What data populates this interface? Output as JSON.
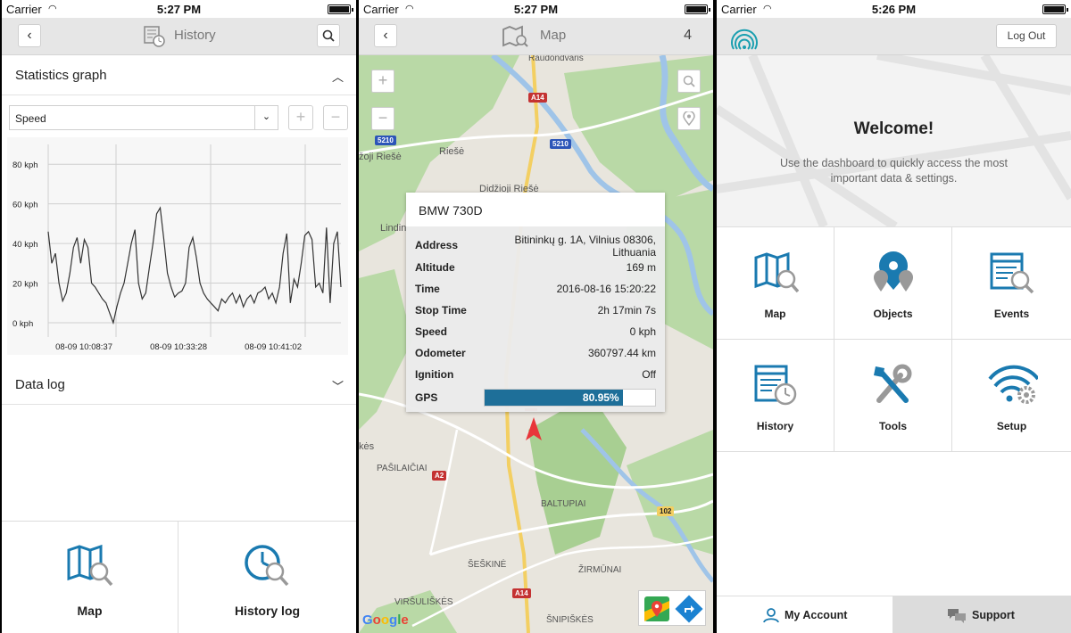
{
  "status": {
    "carrier": "Carrier",
    "time_history": "5:27 PM",
    "time_map": "5:27 PM",
    "time_dashboard": "5:26 PM"
  },
  "history": {
    "title": "History",
    "statistics_label": "Statistics graph",
    "metric_selected": "Speed",
    "data_log_label": "Data log",
    "tiles": [
      {
        "label": "Map"
      },
      {
        "label": "History log"
      }
    ]
  },
  "chart_data": {
    "type": "line",
    "ylabel": "",
    "xlabel": "",
    "ylim": [
      0,
      90
    ],
    "yticks": [
      "0 kph",
      "20 kph",
      "40 kph",
      "60 kph",
      "80 kph"
    ],
    "xticks": [
      "08-09 10:08:37",
      "08-09 10:33:28",
      "08-09 10:41:02"
    ],
    "series": [
      {
        "values": [
          46,
          30,
          35,
          20,
          11,
          15,
          25,
          38,
          43,
          30,
          42,
          38,
          20,
          18,
          15,
          12,
          10,
          5,
          0,
          8,
          15,
          20,
          30,
          40,
          47,
          20,
          12,
          15,
          28,
          40,
          55,
          58,
          42,
          25,
          18,
          13,
          15,
          16,
          20,
          38,
          43,
          33,
          20,
          15,
          12,
          10,
          8,
          6,
          12,
          10,
          13,
          15,
          10,
          14,
          8,
          12,
          14,
          10,
          15,
          16,
          18,
          12,
          15,
          10,
          18,
          35,
          45,
          10,
          22,
          18,
          30,
          44,
          46,
          42,
          18,
          20,
          15,
          48,
          10,
          40,
          46,
          18
        ]
      }
    ],
    "grid": true
  },
  "map": {
    "title": "Map",
    "count": "4",
    "vehicle": "BMW 730D",
    "rows": [
      {
        "k": "Address",
        "v": "Bitininkų g. 1A, Vilnius 08306, Lithuania"
      },
      {
        "k": "Altitude",
        "v": "169 m"
      },
      {
        "k": "Time",
        "v": "2016-08-16 15:20:22"
      },
      {
        "k": "Stop Time",
        "v": "2h 17min 7s"
      },
      {
        "k": "Speed",
        "v": "0 kph"
      },
      {
        "k": "Odometer",
        "v": "360797.44 km"
      },
      {
        "k": "Ignition",
        "v": "Off"
      }
    ],
    "gps_label": "GPS",
    "gps_value": "80.95%",
    "gps_fraction": 0.8095,
    "google": "Google",
    "labels": {
      "raudondvaris": "Raudondvaris",
      "riese": "Riešė",
      "didzioji": "Didžioji Riešė",
      "zoji": "žoji Riešė",
      "lindin": "Lindin",
      "pasilaiciai": "PAŠILAIČIAI",
      "baltupiai": "BALTUPIAI",
      "seskine": "ŠEŠKINĖ",
      "zirmunai": "ŽIRMŪNAI",
      "virsuliskes": "VIRŠULIŠKĖS",
      "snipiskes": "ŠNIPIŠKĖS",
      "kes": "kės",
      "a14a": "A14",
      "a14b": "A14",
      "a2": "A2",
      "r5210a": "5210",
      "r5210b": "5210",
      "r102": "102"
    }
  },
  "dashboard": {
    "logout": "Log Out",
    "welcome_title": "Welcome!",
    "welcome_text": "Use the dashboard to quickly access the most important data & settings.",
    "items": [
      {
        "label": "Map"
      },
      {
        "label": "Objects"
      },
      {
        "label": "Events"
      },
      {
        "label": "History"
      },
      {
        "label": "Tools"
      },
      {
        "label": "Setup"
      }
    ],
    "tab_account": "My Account",
    "tab_support": "Support"
  },
  "colors": {
    "accent": "#1e6f99",
    "icon_blue": "#1a7ab0"
  }
}
